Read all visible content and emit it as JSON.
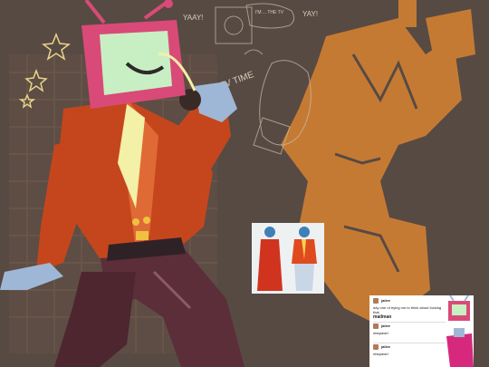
{
  "sketch_text": {
    "speech_left": "YAAY!",
    "speech_bubble": "I'M ... THE TV",
    "speech_right": "YAY!",
    "scribble_caption": "TV TIME"
  },
  "chat_post": {
    "messages": [
      {
        "author": "jaiiee",
        "lines": [
          "day one of trying not to think about fucking that",
          "mailman"
        ]
      },
      {
        "author": "jaiiee",
        "lines": [
          "nfaqrawrt"
        ]
      },
      {
        "author": "jaiiee",
        "lines": [
          "nfaqrawrt"
        ]
      }
    ]
  },
  "colors": {
    "background": "#574a43",
    "suit_red": "#c5461d",
    "tv_pink": "#d94a78",
    "screen_mint": "#c8efc3",
    "sketch_orange": "#c57a33",
    "pants_maroon": "#5c2e3a"
  }
}
